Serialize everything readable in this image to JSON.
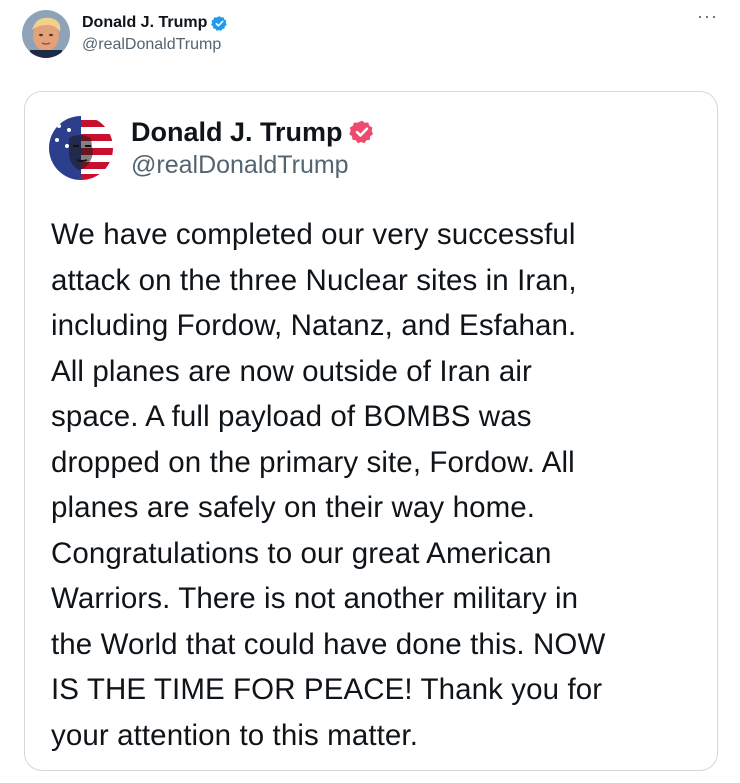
{
  "post": {
    "author": {
      "name": "Donald J. Trump",
      "handle": "@realDonaldTrump",
      "avatar_icon": "profile-photo",
      "verified_icon": "verified-badge-icon"
    },
    "more_menu": "···"
  },
  "embedded_post": {
    "author": {
      "name": "Donald J. Trump",
      "handle": "@realDonaldTrump",
      "avatar_icon": "flag-face-avatar",
      "verified_icon": "verified-badge-icon"
    },
    "text": "We have completed our very successful\nattack on the three Nuclear sites in Iran,\nincluding Fordow, Natanz, and Esfahan.\nAll planes are now outside of Iran air\nspace. A full payload of BOMBS was\ndropped on the primary site, Fordow. All\nplanes are safely on their way home.\nCongratulations to our great American\nWarriors. There is not another military in\nthe World that could have done this. NOW\nIS THE TIME FOR PEACE! Thank you for\nyour attention to this matter."
  },
  "colors": {
    "verified_top": "#1d9bf0",
    "verified_card": "#ec4b6e",
    "text_primary": "#0f1419",
    "text_secondary": "#536471",
    "border": "#cfd9de"
  }
}
